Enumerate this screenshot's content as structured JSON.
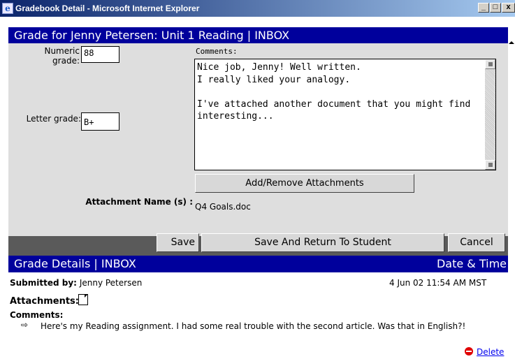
{
  "window": {
    "title": "Gradebook Detail - Microsoft Internet Explorer",
    "min_label": "_",
    "max_label": "□",
    "close_label": "x"
  },
  "grade_header": "Grade for Jenny Petersen: Unit 1 Reading | INBOX",
  "form": {
    "numeric_label": "Numeric grade:",
    "numeric_value": "88",
    "letter_label": "Letter grade:",
    "letter_value": "B+",
    "comments_label": "Comments:",
    "comments_value": "Nice job, Jenny! Well written.\nI really liked your analogy.\n\nI've attached another document that you might find interesting...",
    "add_remove_label": "Add/Remove Attachments",
    "attachment_label": "Attachment Name (s) :",
    "attachment_value": "Q4 Goals.doc"
  },
  "buttons": {
    "save": "Save",
    "save_return": "Save And Return To Student",
    "cancel": "Cancel"
  },
  "details": {
    "header_left": "Grade Details | INBOX",
    "header_right": "Date & Time",
    "submitted_label": "Submitted by:",
    "submitted_value": "Jenny Petersen",
    "date_value": "4 Jun 02  11:54 AM MST",
    "attachments_label": "Attachments:",
    "comments_label": "Comments:",
    "comment_text": "Here's my Reading assignment. I had some real trouble with the second article. Was that in English?!",
    "delete_label": "Delete"
  },
  "colors": {
    "header_bg": "#00009c",
    "link": "#0000ee",
    "delete_icon": "#e00000"
  }
}
